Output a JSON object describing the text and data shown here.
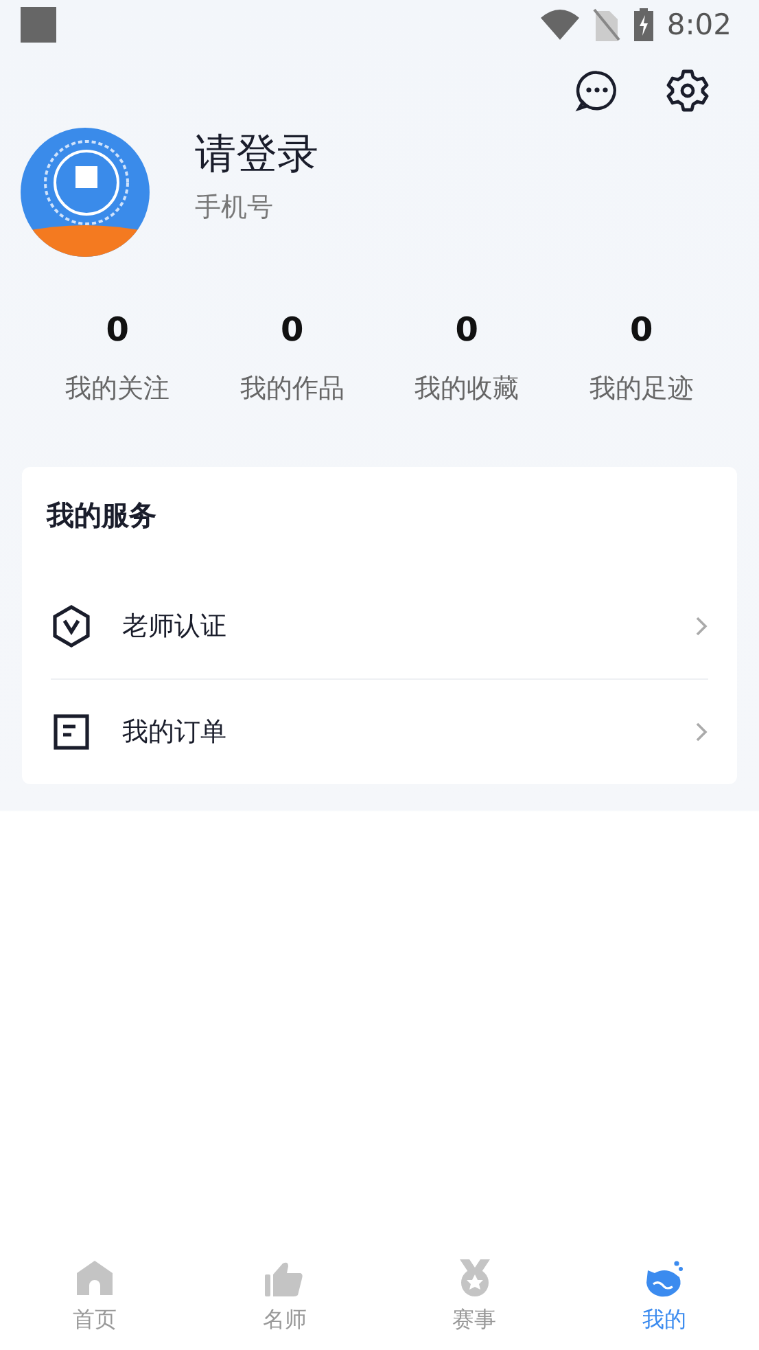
{
  "status_bar": {
    "time": "8:02"
  },
  "profile": {
    "name": "请登录",
    "subtitle": "手机号"
  },
  "stats": [
    {
      "value": "0",
      "label": "我的关注"
    },
    {
      "value": "0",
      "label": "我的作品"
    },
    {
      "value": "0",
      "label": "我的收藏"
    },
    {
      "value": "0",
      "label": "我的足迹"
    }
  ],
  "services": {
    "title": "我的服务",
    "items": [
      {
        "kind": "verify",
        "label": "老师认证"
      },
      {
        "kind": "order",
        "label": "我的订单"
      }
    ]
  },
  "tabs": [
    {
      "kind": "home",
      "label": "首页",
      "selected": false
    },
    {
      "kind": "like",
      "label": "名师",
      "selected": false
    },
    {
      "kind": "medal",
      "label": "赛事",
      "selected": false
    },
    {
      "kind": "mine",
      "label": "我的",
      "selected": true
    }
  ]
}
